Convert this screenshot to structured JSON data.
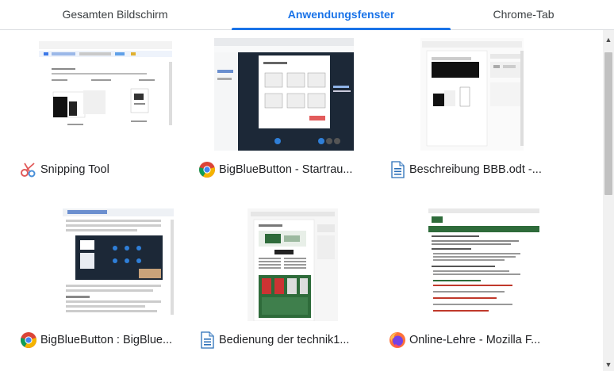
{
  "tabs": {
    "entire_screen": "Gesamten Bildschirm",
    "app_window": "Anwendungsfenster",
    "chrome_tab": "Chrome-Tab"
  },
  "windows": [
    {
      "title": "Snipping Tool",
      "icon": "snipping-tool-icon"
    },
    {
      "title": "BigBlueButton - Startrau...",
      "icon": "chrome-icon"
    },
    {
      "title": "Beschreibung BBB.odt -...",
      "icon": "writer-document-icon"
    },
    {
      "title": "BigBlueButton : BigBlue...",
      "icon": "chrome-icon"
    },
    {
      "title": "Bedienung der technik1...",
      "icon": "writer-document-icon"
    },
    {
      "title": "Online-Lehre - Mozilla F...",
      "icon": "firefox-icon"
    }
  ],
  "colors": {
    "accent": "#1a73e8",
    "bbb_dark": "#1c2837",
    "green_header": "#2e6b3a"
  }
}
